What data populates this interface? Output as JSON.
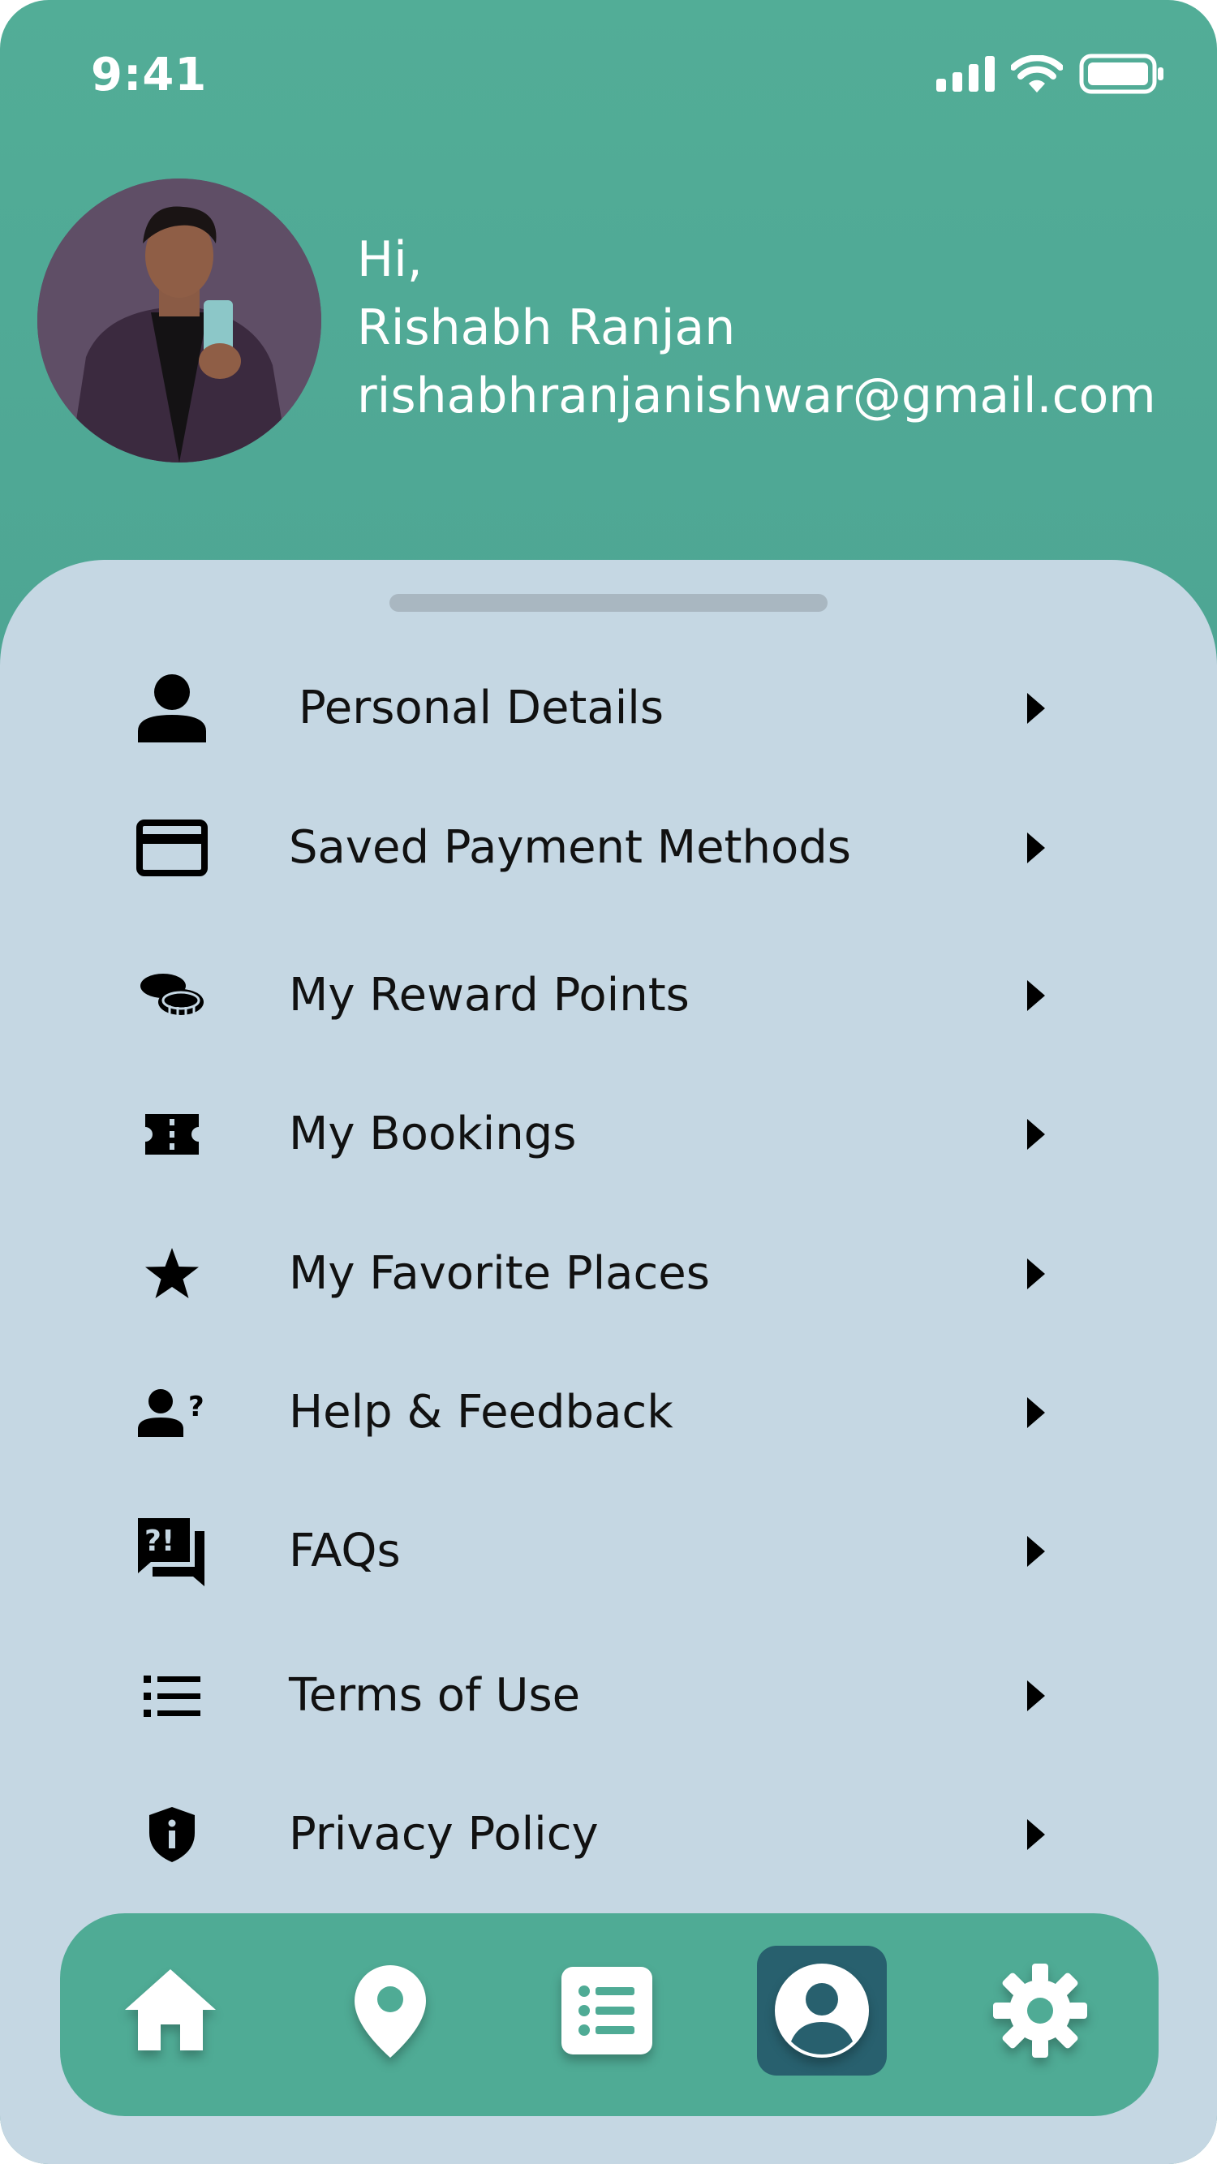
{
  "status_bar": {
    "time": "9:41"
  },
  "profile": {
    "greeting": "Hi,",
    "name": "Rishabh Ranjan",
    "email": "rishabhranjanishwar@gmail.com"
  },
  "menu": {
    "items": [
      {
        "label": "Personal Details",
        "icon": "person-icon"
      },
      {
        "label": "Saved Payment Methods",
        "icon": "credit-card-icon"
      },
      {
        "label": "My Reward Points",
        "icon": "coins-icon"
      },
      {
        "label": "My Bookings",
        "icon": "ticket-icon"
      },
      {
        "label": "My Favorite Places",
        "icon": "star-icon"
      },
      {
        "label": "Help & Feedback",
        "icon": "person-question-icon"
      },
      {
        "label": "FAQs",
        "icon": "faq-chat-icon"
      },
      {
        "label": "Terms of Use",
        "icon": "list-icon"
      },
      {
        "label": "Privacy Policy",
        "icon": "shield-info-icon"
      }
    ]
  },
  "bottom_nav": {
    "items": [
      "home-icon",
      "location-pin-icon",
      "list-icon",
      "profile-icon",
      "settings-gear-icon"
    ],
    "active": "profile-icon"
  },
  "colors": {
    "header_green": "#52ad97",
    "sheet": "#c5d7e3",
    "nav_bar": "#4fab95",
    "nav_active": "#28606e"
  }
}
